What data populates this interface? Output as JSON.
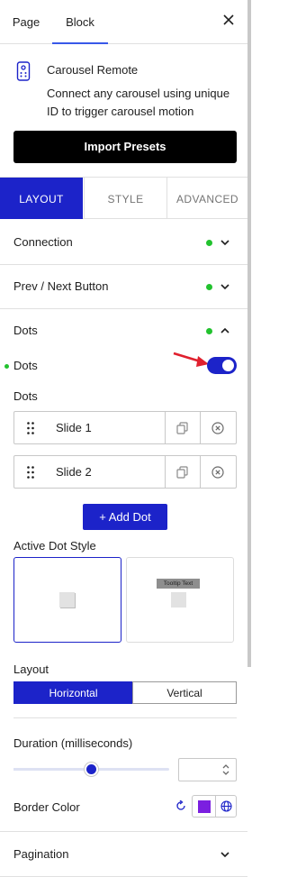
{
  "header": {
    "tabs": [
      {
        "label": "Page",
        "active": false
      },
      {
        "label": "Block",
        "active": true
      }
    ],
    "close_icon": "close-icon"
  },
  "block": {
    "icon": "remote-control-icon",
    "title": "Carousel Remote",
    "description": "Connect any carousel using unique ID to trigger carousel motion",
    "import_label": "Import Presets"
  },
  "section_tabs": [
    {
      "label": "LAYOUT",
      "active": true
    },
    {
      "label": "STYLE",
      "active": false
    },
    {
      "label": "ADVANCED",
      "active": false
    }
  ],
  "panels": {
    "connection": {
      "label": "Connection",
      "status": "active",
      "expanded": false
    },
    "prev_next": {
      "label": "Prev / Next Button",
      "status": "active",
      "expanded": false
    },
    "dots": {
      "label": "Dots",
      "status": "active",
      "expanded": true
    },
    "pagination": {
      "label": "Pagination",
      "expanded": false
    }
  },
  "dots_panel": {
    "toggle_label": "Dots",
    "toggle_on": true,
    "list_label": "Dots",
    "items": [
      {
        "label": "Slide 1"
      },
      {
        "label": "Slide 2"
      }
    ],
    "add_label": "+ Add Dot",
    "active_style_label": "Active Dot Style",
    "style_options": [
      {
        "name": "plain",
        "selected": true
      },
      {
        "name": "tooltip",
        "selected": false,
        "tooltip_text": "Tooltip Text"
      }
    ],
    "layout_label": "Layout",
    "layout_options": [
      {
        "label": "Horizontal",
        "selected": true
      },
      {
        "label": "Vertical",
        "selected": false
      }
    ],
    "duration_label": "Duration (milliseconds)",
    "duration_value": "",
    "duration_slider_fraction": 0.5,
    "border_color_label": "Border Color",
    "border_color": "#7b1fe0"
  },
  "colors": {
    "accent": "#1c23c9",
    "tab_underline": "#3858e9",
    "status_green": "#22c22e",
    "arrow": "#e0202e"
  }
}
